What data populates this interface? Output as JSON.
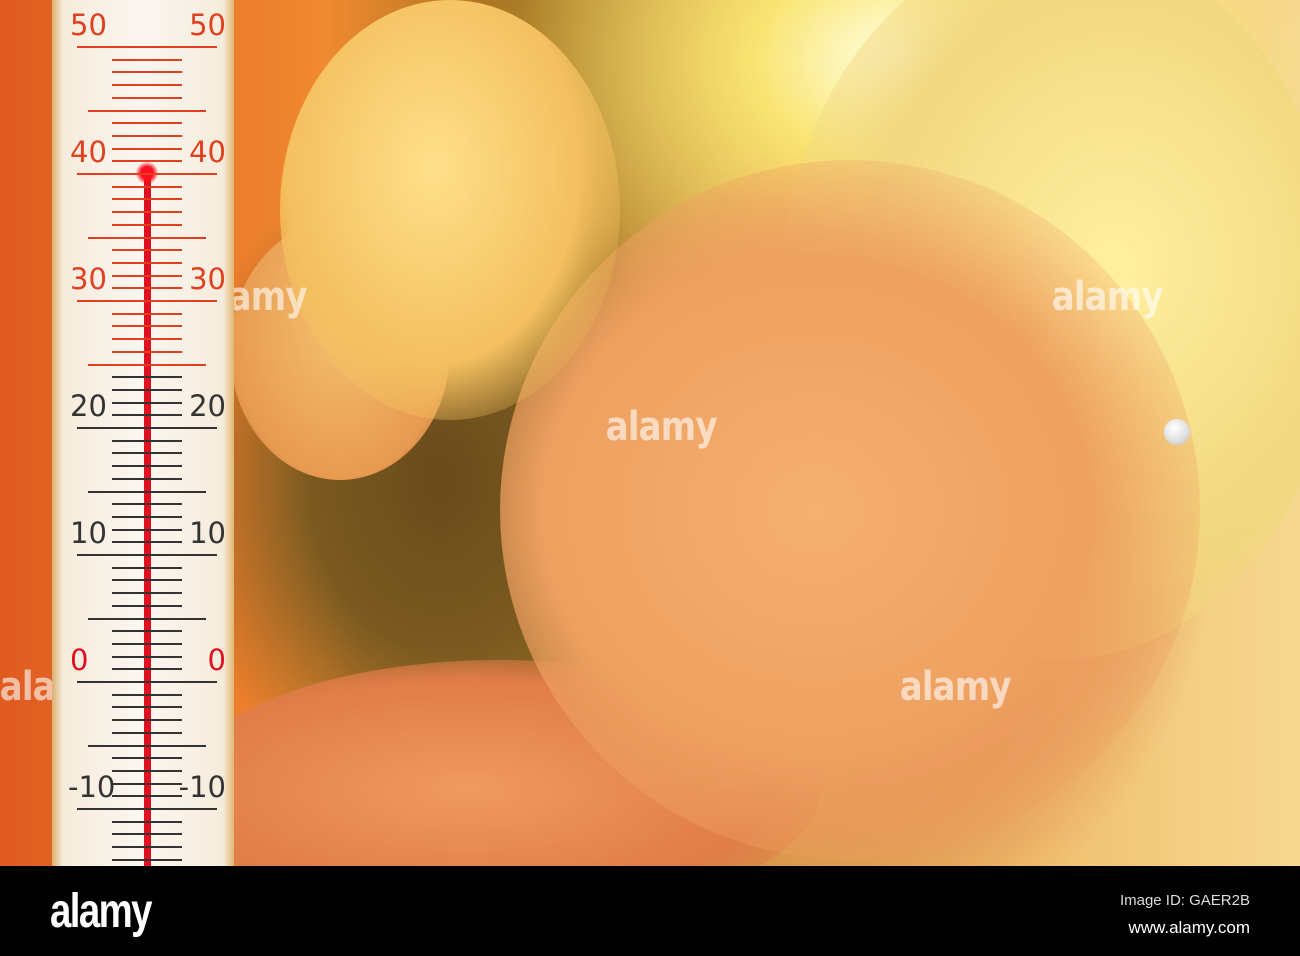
{
  "thermometer": {
    "scale_min": -10,
    "scale_max": 50,
    "reading_celsius": 40,
    "labels": [
      "50",
      "40",
      "30",
      "20",
      "10",
      "0",
      "-10"
    ],
    "colors": {
      "mercury": "#e01020",
      "hot_marks": "#e04020",
      "cool_marks": "#333333"
    }
  },
  "watermark": {
    "text": "alamy"
  },
  "footer": {
    "logo": "alamy",
    "image_id": "Image ID: GAER2B",
    "url": "www.alamy.com"
  }
}
